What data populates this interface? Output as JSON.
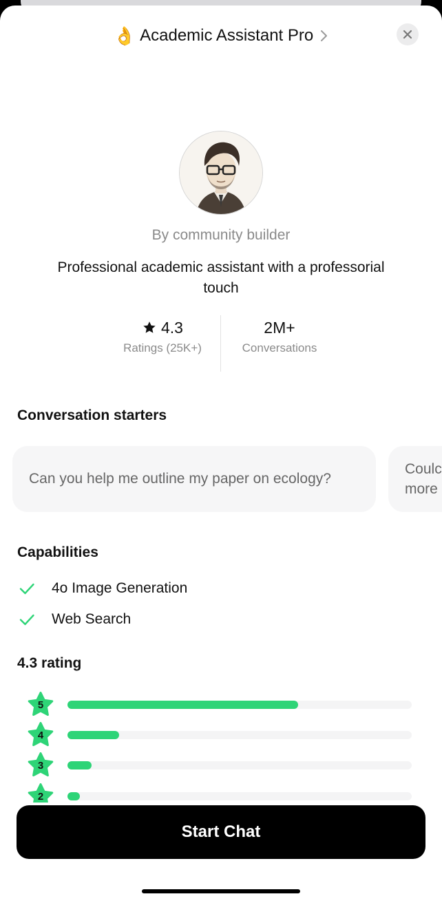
{
  "header": {
    "emoji": "👌",
    "title": "Academic Assistant Pro"
  },
  "profile": {
    "byline": "By community builder",
    "description": "Professional academic assistant with a professorial touch"
  },
  "stats": {
    "rating_value": "4.3",
    "rating_label": "Ratings (25K+)",
    "conversations_value": "2M+",
    "conversations_label": "Conversations"
  },
  "starters": {
    "title": "Conversation starters",
    "items": [
      "Can you help me outline my paper on ecology?",
      "Could you … more"
    ],
    "partial_second": [
      "Coulc",
      "more"
    ]
  },
  "capabilities": {
    "title": "Capabilities",
    "items": [
      "4o Image Generation",
      "Web Search"
    ]
  },
  "rating_breakdown": {
    "title": "4.3 rating",
    "rows": [
      {
        "stars": "5",
        "fraction": 0.67
      },
      {
        "stars": "4",
        "fraction": 0.15
      },
      {
        "stars": "3",
        "fraction": 0.07
      },
      {
        "stars": "2",
        "fraction": 0.035
      }
    ]
  },
  "action": {
    "start_label": "Start Chat"
  },
  "colors": {
    "accent_green": "#2ed477",
    "button_bg": "#000000"
  }
}
